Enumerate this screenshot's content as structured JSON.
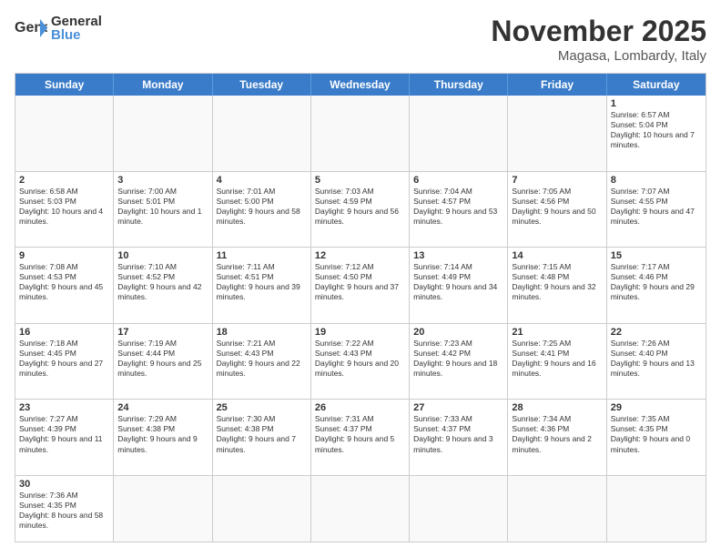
{
  "logo": {
    "text_general": "General",
    "text_blue": "Blue"
  },
  "header": {
    "month": "November 2025",
    "location": "Magasa, Lombardy, Italy"
  },
  "weekdays": [
    "Sunday",
    "Monday",
    "Tuesday",
    "Wednesday",
    "Thursday",
    "Friday",
    "Saturday"
  ],
  "rows": [
    [
      {
        "day": "",
        "info": ""
      },
      {
        "day": "",
        "info": ""
      },
      {
        "day": "",
        "info": ""
      },
      {
        "day": "",
        "info": ""
      },
      {
        "day": "",
        "info": ""
      },
      {
        "day": "",
        "info": ""
      },
      {
        "day": "1",
        "info": "Sunrise: 6:57 AM\nSunset: 5:04 PM\nDaylight: 10 hours and 7 minutes."
      }
    ],
    [
      {
        "day": "2",
        "info": "Sunrise: 6:58 AM\nSunset: 5:03 PM\nDaylight: 10 hours and 4 minutes."
      },
      {
        "day": "3",
        "info": "Sunrise: 7:00 AM\nSunset: 5:01 PM\nDaylight: 10 hours and 1 minute."
      },
      {
        "day": "4",
        "info": "Sunrise: 7:01 AM\nSunset: 5:00 PM\nDaylight: 9 hours and 58 minutes."
      },
      {
        "day": "5",
        "info": "Sunrise: 7:03 AM\nSunset: 4:59 PM\nDaylight: 9 hours and 56 minutes."
      },
      {
        "day": "6",
        "info": "Sunrise: 7:04 AM\nSunset: 4:57 PM\nDaylight: 9 hours and 53 minutes."
      },
      {
        "day": "7",
        "info": "Sunrise: 7:05 AM\nSunset: 4:56 PM\nDaylight: 9 hours and 50 minutes."
      },
      {
        "day": "8",
        "info": "Sunrise: 7:07 AM\nSunset: 4:55 PM\nDaylight: 9 hours and 47 minutes."
      }
    ],
    [
      {
        "day": "9",
        "info": "Sunrise: 7:08 AM\nSunset: 4:53 PM\nDaylight: 9 hours and 45 minutes."
      },
      {
        "day": "10",
        "info": "Sunrise: 7:10 AM\nSunset: 4:52 PM\nDaylight: 9 hours and 42 minutes."
      },
      {
        "day": "11",
        "info": "Sunrise: 7:11 AM\nSunset: 4:51 PM\nDaylight: 9 hours and 39 minutes."
      },
      {
        "day": "12",
        "info": "Sunrise: 7:12 AM\nSunset: 4:50 PM\nDaylight: 9 hours and 37 minutes."
      },
      {
        "day": "13",
        "info": "Sunrise: 7:14 AM\nSunset: 4:49 PM\nDaylight: 9 hours and 34 minutes."
      },
      {
        "day": "14",
        "info": "Sunrise: 7:15 AM\nSunset: 4:48 PM\nDaylight: 9 hours and 32 minutes."
      },
      {
        "day": "15",
        "info": "Sunrise: 7:17 AM\nSunset: 4:46 PM\nDaylight: 9 hours and 29 minutes."
      }
    ],
    [
      {
        "day": "16",
        "info": "Sunrise: 7:18 AM\nSunset: 4:45 PM\nDaylight: 9 hours and 27 minutes."
      },
      {
        "day": "17",
        "info": "Sunrise: 7:19 AM\nSunset: 4:44 PM\nDaylight: 9 hours and 25 minutes."
      },
      {
        "day": "18",
        "info": "Sunrise: 7:21 AM\nSunset: 4:43 PM\nDaylight: 9 hours and 22 minutes."
      },
      {
        "day": "19",
        "info": "Sunrise: 7:22 AM\nSunset: 4:43 PM\nDaylight: 9 hours and 20 minutes."
      },
      {
        "day": "20",
        "info": "Sunrise: 7:23 AM\nSunset: 4:42 PM\nDaylight: 9 hours and 18 minutes."
      },
      {
        "day": "21",
        "info": "Sunrise: 7:25 AM\nSunset: 4:41 PM\nDaylight: 9 hours and 16 minutes."
      },
      {
        "day": "22",
        "info": "Sunrise: 7:26 AM\nSunset: 4:40 PM\nDaylight: 9 hours and 13 minutes."
      }
    ],
    [
      {
        "day": "23",
        "info": "Sunrise: 7:27 AM\nSunset: 4:39 PM\nDaylight: 9 hours and 11 minutes."
      },
      {
        "day": "24",
        "info": "Sunrise: 7:29 AM\nSunset: 4:38 PM\nDaylight: 9 hours and 9 minutes."
      },
      {
        "day": "25",
        "info": "Sunrise: 7:30 AM\nSunset: 4:38 PM\nDaylight: 9 hours and 7 minutes."
      },
      {
        "day": "26",
        "info": "Sunrise: 7:31 AM\nSunset: 4:37 PM\nDaylight: 9 hours and 5 minutes."
      },
      {
        "day": "27",
        "info": "Sunrise: 7:33 AM\nSunset: 4:37 PM\nDaylight: 9 hours and 3 minutes."
      },
      {
        "day": "28",
        "info": "Sunrise: 7:34 AM\nSunset: 4:36 PM\nDaylight: 9 hours and 2 minutes."
      },
      {
        "day": "29",
        "info": "Sunrise: 7:35 AM\nSunset: 4:35 PM\nDaylight: 9 hours and 0 minutes."
      }
    ],
    [
      {
        "day": "30",
        "info": "Sunrise: 7:36 AM\nSunset: 4:35 PM\nDaylight: 8 hours and 58 minutes."
      },
      {
        "day": "",
        "info": ""
      },
      {
        "day": "",
        "info": ""
      },
      {
        "day": "",
        "info": ""
      },
      {
        "day": "",
        "info": ""
      },
      {
        "day": "",
        "info": ""
      },
      {
        "day": "",
        "info": ""
      }
    ]
  ]
}
